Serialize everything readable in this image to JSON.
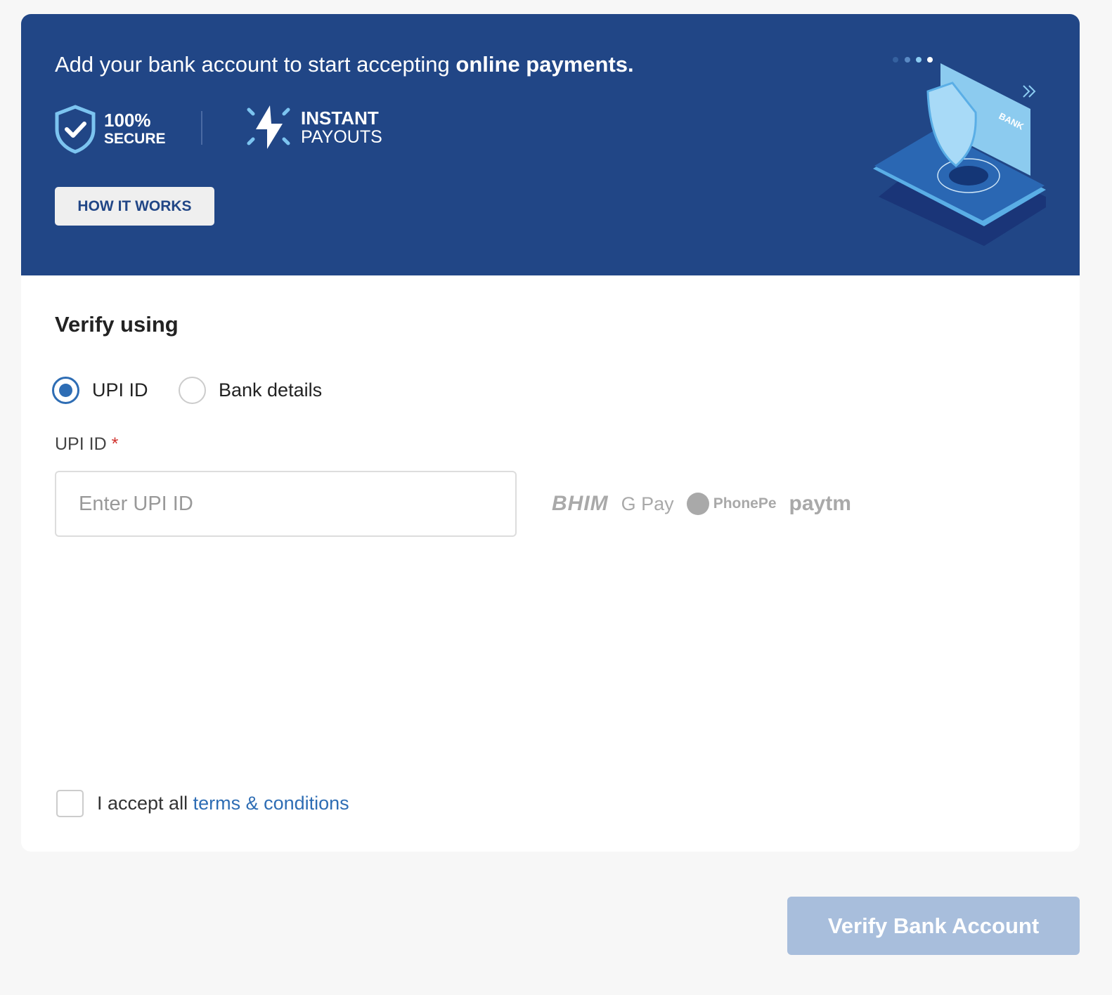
{
  "banner": {
    "headline_prefix": "Add your bank account to start accepting ",
    "headline_bold": "online payments.",
    "feature_secure": {
      "line1": "100%",
      "line2": "SECURE",
      "icon": "shield-check-icon"
    },
    "feature_instant": {
      "line1": "INSTANT",
      "line2": "PAYOUTS",
      "icon": "lightning-icon"
    },
    "how_it_works_label": "HOW IT WORKS",
    "illustration_text": "BANK",
    "color": "#214686"
  },
  "form": {
    "title": "Verify using",
    "options": [
      {
        "label": "UPI ID",
        "selected": true
      },
      {
        "label": "Bank details",
        "selected": false
      }
    ],
    "upi_label": "UPI ID",
    "required_mark": "*",
    "upi_placeholder": "Enter UPI ID",
    "upi_value": "",
    "logos": [
      "BHIM",
      "G Pay",
      "PhonePe",
      "paytm"
    ],
    "terms_prefix": "I accept all ",
    "terms_link": "terms & conditions",
    "terms_checked": false
  },
  "footer": {
    "verify_label": "Verify Bank Account",
    "verify_enabled": false
  },
  "colors": {
    "accent": "#2e6db4",
    "required": "#d0312d",
    "disabled_button": "#a8bedc"
  }
}
